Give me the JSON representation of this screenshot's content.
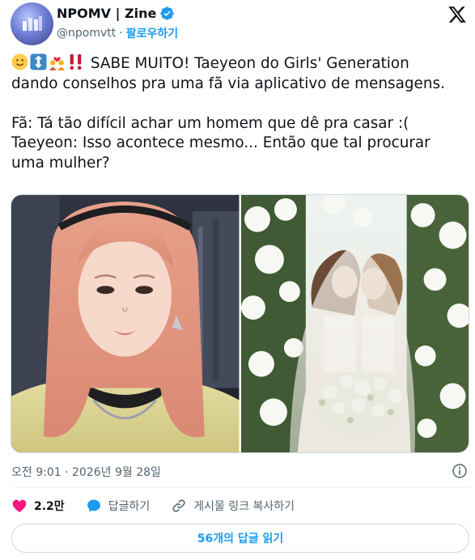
{
  "account": {
    "display_name": "NPOMV | Zine",
    "handle": "@npomvtt",
    "separator": "·",
    "follow_label": "팔로우하기",
    "verified_icon": "verified-badge-icon",
    "avatar_icon": "npomv-logo"
  },
  "top_right_icon": "x-logo-icon",
  "tweet": {
    "emojis": [
      "slightly-smiling-face",
      "up-down-arrow",
      "couple-with-heart-women",
      "double-exclamation-mark"
    ],
    "lines": [
      "SABE MUITO! Taeyeon do Girls' Generation",
      "dando conselhos pra uma fã via aplicativo de mensagens.",
      "Fã: Tá tão difícil achar um homem que dê pra casar :(",
      "Taeyeon: Isso acontece mesmo... Então que tal procurar",
      "uma mulher?"
    ]
  },
  "media": {
    "photos": [
      {
        "name": "selfie-photo",
        "description_icon": "photo"
      },
      {
        "name": "wedding-photo",
        "description_icon": "photo"
      }
    ]
  },
  "timestamp": "오전 9:01 · 2026년 9월 28일",
  "actions": {
    "like_count": "2.2만",
    "reply_label": "답글하기",
    "copy_link_label": "게시물 링크 복사하기"
  },
  "read_replies_label": "56개의 답글 읽기",
  "colors": {
    "accent": "#1d9bf0",
    "like": "#f91880",
    "text": "#0f1419",
    "muted": "#536471",
    "border": "#cfd9de"
  }
}
